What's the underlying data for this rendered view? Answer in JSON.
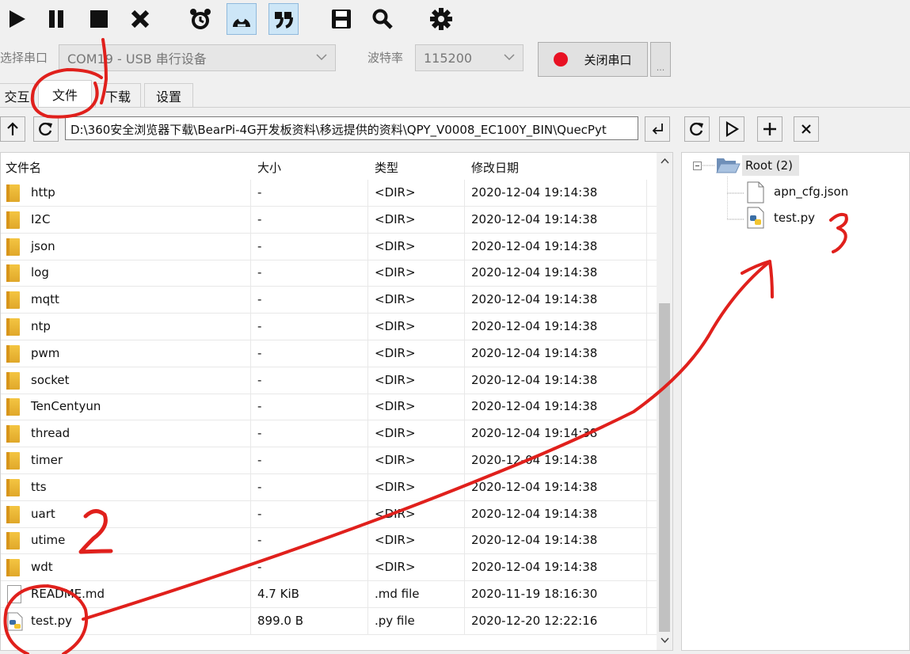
{
  "serial": {
    "port_label": "选择串口",
    "port_value": "COM19 - USB 串行设备",
    "baud_label": "波特率",
    "baud_value": "115200",
    "close_label": "关闭串口",
    "more_label": "..."
  },
  "tabs": [
    {
      "label": "交互"
    },
    {
      "label": "文件"
    },
    {
      "label": "下载"
    },
    {
      "label": "设置"
    }
  ],
  "path": "D:\\360安全浏览器下载\\BearPi-4G开发板资料\\移远提供的资料\\QPY_V0008_EC100Y_BIN\\QuecPyt",
  "columns": {
    "name": "文件名",
    "size": "大小",
    "type": "类型",
    "date": "修改日期"
  },
  "files": [
    {
      "name": "http",
      "size": "-",
      "type": "<DIR>",
      "date": "2020-12-04 19:14:38",
      "kind": "folder"
    },
    {
      "name": "I2C",
      "size": "-",
      "type": "<DIR>",
      "date": "2020-12-04 19:14:38",
      "kind": "folder"
    },
    {
      "name": "json",
      "size": "-",
      "type": "<DIR>",
      "date": "2020-12-04 19:14:38",
      "kind": "folder"
    },
    {
      "name": "log",
      "size": "-",
      "type": "<DIR>",
      "date": "2020-12-04 19:14:38",
      "kind": "folder"
    },
    {
      "name": "mqtt",
      "size": "-",
      "type": "<DIR>",
      "date": "2020-12-04 19:14:38",
      "kind": "folder"
    },
    {
      "name": "ntp",
      "size": "-",
      "type": "<DIR>",
      "date": "2020-12-04 19:14:38",
      "kind": "folder"
    },
    {
      "name": "pwm",
      "size": "-",
      "type": "<DIR>",
      "date": "2020-12-04 19:14:38",
      "kind": "folder"
    },
    {
      "name": "socket",
      "size": "-",
      "type": "<DIR>",
      "date": "2020-12-04 19:14:38",
      "kind": "folder"
    },
    {
      "name": "TenCentyun",
      "size": "-",
      "type": "<DIR>",
      "date": "2020-12-04 19:14:38",
      "kind": "folder"
    },
    {
      "name": "thread",
      "size": "-",
      "type": "<DIR>",
      "date": "2020-12-04 19:14:38",
      "kind": "folder"
    },
    {
      "name": "timer",
      "size": "-",
      "type": "<DIR>",
      "date": "2020-12-04 19:14:38",
      "kind": "folder"
    },
    {
      "name": "tts",
      "size": "-",
      "type": "<DIR>",
      "date": "2020-12-04 19:14:38",
      "kind": "folder"
    },
    {
      "name": "uart",
      "size": "-",
      "type": "<DIR>",
      "date": "2020-12-04 19:14:38",
      "kind": "folder"
    },
    {
      "name": "utime",
      "size": "-",
      "type": "<DIR>",
      "date": "2020-12-04 19:14:38",
      "kind": "folder"
    },
    {
      "name": "wdt",
      "size": "-",
      "type": "<DIR>",
      "date": "2020-12-04 19:14:38",
      "kind": "folder"
    },
    {
      "name": "README.md",
      "size": "4.7 KiB",
      "type": ".md file",
      "date": "2020-11-19 18:16:30",
      "kind": "file"
    },
    {
      "name": "test.py",
      "size": "899.0 B",
      "type": ".py file",
      "date": "2020-12-20 12:22:16",
      "kind": "py"
    }
  ],
  "tree": {
    "root": "Root (2)",
    "children": [
      {
        "name": "apn_cfg.json",
        "kind": "file"
      },
      {
        "name": "test.py",
        "kind": "py"
      }
    ]
  },
  "annotations": {
    "mark2": "2",
    "mark3": "3"
  },
  "colors": {
    "accent": "#cde6f7",
    "record": "#e81123",
    "ink": "#e0201c",
    "folder": "#f0b93a"
  }
}
